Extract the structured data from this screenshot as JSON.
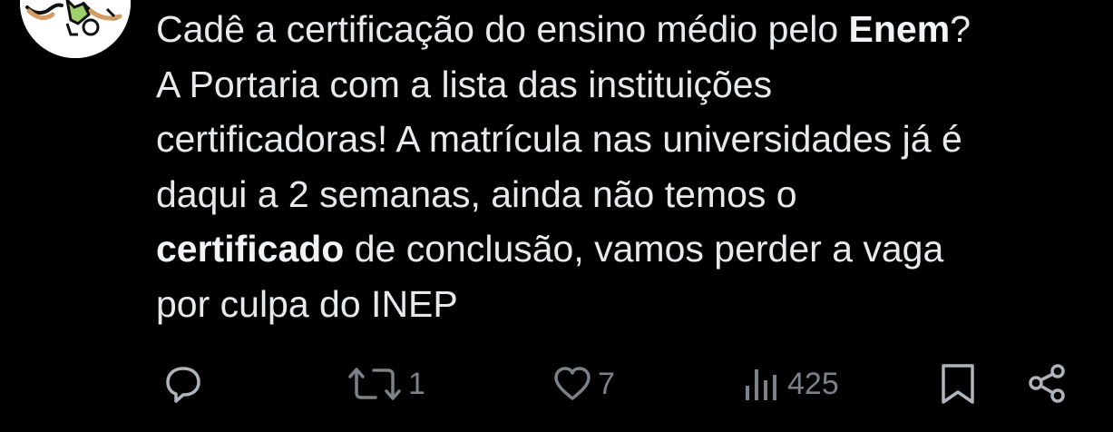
{
  "tweet": {
    "lines": [
      {
        "pre": "Cadê a certificação do ensino médio pelo ",
        "bold": "Enem",
        "post": "?"
      },
      {
        "pre": "A Portaria com a lista das instituições",
        "bold": "",
        "post": ""
      },
      {
        "pre": "certificadoras! A matrícula nas universidades já é",
        "bold": "",
        "post": ""
      },
      {
        "pre": "daqui a 2 semanas, ainda não temos o",
        "bold": "",
        "post": ""
      },
      {
        "pre": "",
        "bold": "certificado",
        "post": " de conclusão, vamos perder a vaga"
      },
      {
        "pre": "por culpa do INEP",
        "bold": "",
        "post": ""
      }
    ]
  },
  "actions": {
    "reply": {
      "icon": "reply-icon"
    },
    "retweet": {
      "icon": "retweet-icon",
      "count": "1"
    },
    "like": {
      "icon": "heart-icon",
      "count": "7"
    },
    "views": {
      "icon": "views-chart-icon",
      "count": "425"
    },
    "bookmark": {
      "icon": "bookmark-icon"
    },
    "share": {
      "icon": "share-icon"
    }
  },
  "colors": {
    "background": "#000000",
    "text": "#e7e9ea",
    "muted": "#7b8188",
    "icon": "#aeb4ba"
  }
}
